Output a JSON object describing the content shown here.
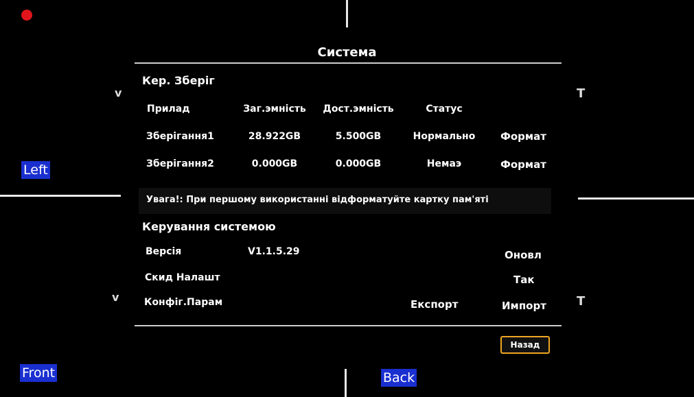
{
  "overlay": {
    "left_label": "Left",
    "front_label": "Front",
    "back_label": "Back",
    "chevron": "v",
    "tee": "T",
    "rec_color": "#e0151b",
    "label_bg": "#1a2fd0"
  },
  "dialog": {
    "title": "Система",
    "storage": {
      "title": "Кер. Зберіг",
      "headers": [
        "Прилад",
        "Заг.эмність",
        "Дост.эмність",
        "Статус"
      ],
      "rows": [
        {
          "device": "Зберігання1",
          "total": "28.922GB",
          "available": "5.500GB",
          "status": "Нормально",
          "action": "Формат"
        },
        {
          "device": "Зберігання2",
          "total": "0.000GB",
          "available": "0.000GB",
          "status": "Немаэ",
          "action": "Формат"
        }
      ],
      "warning": "Увага!: При першому використанні відформатуйте картку пам'яті"
    },
    "system": {
      "title": "Керування системою",
      "version_label": "Версія",
      "version_value": "V1.1.5.29",
      "update_button": "Оновл",
      "reset_label": "Скид Налашт",
      "reset_button": "Так",
      "config_label": "Конфіг.Парам",
      "export_button": "Експорт",
      "import_button": "Импорт"
    },
    "back_button": "Назад",
    "back_button_color": "#f0a623"
  }
}
